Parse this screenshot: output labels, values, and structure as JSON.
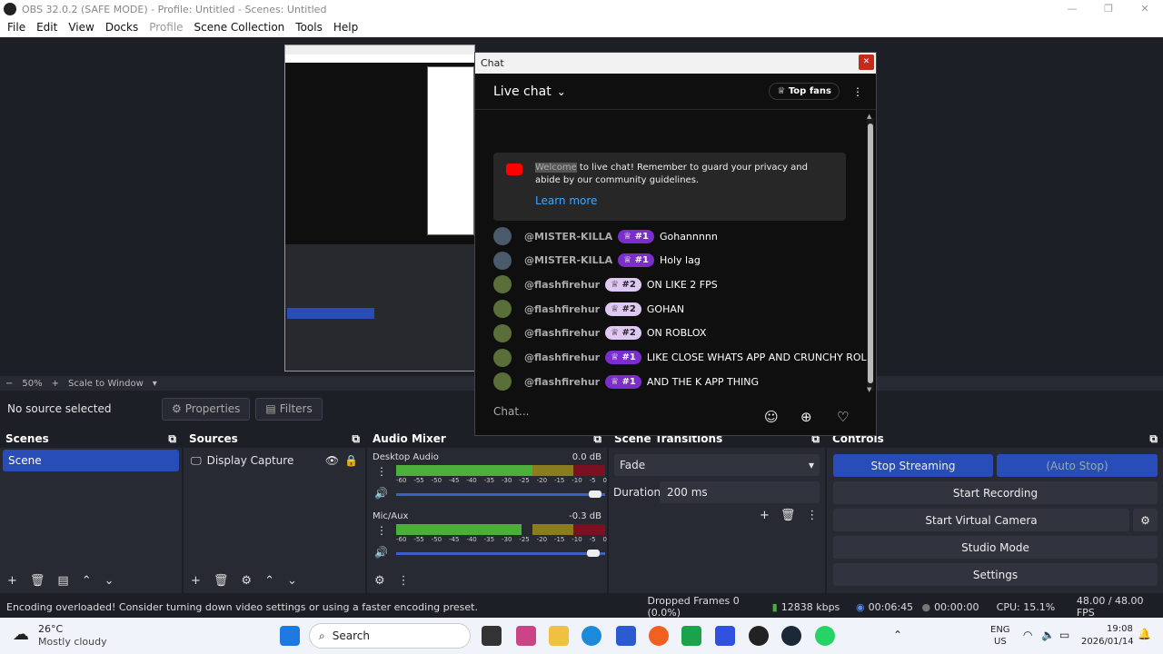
{
  "window": {
    "title": "OBS 32.0.2 (SAFE MODE) - Profile: Untitled - Scenes: Untitled"
  },
  "menu": [
    "File",
    "Edit",
    "View",
    "Docks",
    "Profile",
    "Scene Collection",
    "Tools",
    "Help"
  ],
  "preview": {
    "zoom": "50%",
    "scale_mode": "Scale to Window"
  },
  "propbar": {
    "no_source": "No source selected",
    "properties": "Properties",
    "filters": "Filters"
  },
  "scenes": {
    "title": "Scenes",
    "items": [
      "Scene"
    ]
  },
  "sources": {
    "title": "Sources",
    "items": [
      "Display Capture"
    ]
  },
  "mixer": {
    "title": "Audio Mixer",
    "tracks": [
      {
        "name": "Desktop Audio",
        "db": "0.0 dB",
        "level": 0.65
      },
      {
        "name": "Mic/Aux",
        "db": "-0.3 dB",
        "level": 0.6
      }
    ],
    "ticks": [
      "-60",
      "-55",
      "-50",
      "-45",
      "-40",
      "-35",
      "-30",
      "-25",
      "-20",
      "-15",
      "-10",
      "-5",
      "0"
    ]
  },
  "transitions": {
    "title": "Scene Transitions",
    "type": "Fade",
    "duration_label": "Duration",
    "duration": "200 ms"
  },
  "controls": {
    "title": "Controls",
    "stop_streaming": "Stop Streaming",
    "auto_stop": "(Auto Stop)",
    "start_recording": "Start Recording",
    "start_virtual_camera": "Start Virtual Camera",
    "studio_mode": "Studio Mode",
    "settings": "Settings"
  },
  "status": {
    "message": "Encoding overloaded! Consider turning down video settings or using a faster encoding preset.",
    "dropped": "Dropped Frames 0 (0.0%)",
    "bitrate": "12838 kbps",
    "stream_time": "00:06:45",
    "rec_time": "00:00:00",
    "cpu": "CPU: 15.1%",
    "fps": "48.00 / 48.00 FPS"
  },
  "chat": {
    "window_title": "Chat",
    "live_chat": "Live chat",
    "top_fans": "Top fans",
    "welcome_highlight": "Welcome",
    "welcome_text": " to live chat! Remember to guard your privacy and abide by our community guidelines.",
    "learn_more": "Learn more",
    "placeholder": "Chat...",
    "messages": [
      {
        "user": "@MISTER-KILLA",
        "badge": "#1",
        "text": "Gohannnnn"
      },
      {
        "user": "@MISTER-KILLA",
        "badge": "#1",
        "text": "Holy lag"
      },
      {
        "user": "@flashfirehur",
        "badge": "#2",
        "text": "ON LIKE 2 FPS"
      },
      {
        "user": "@flashfirehur",
        "badge": "#2",
        "text": "GOHAN"
      },
      {
        "user": "@flashfirehur",
        "badge": "#2",
        "text": "ON ROBLOX"
      },
      {
        "user": "@flashfirehur",
        "badge": "#1",
        "text": "LIKE CLOSE WHATS APP AND CRUNCHY ROLL"
      },
      {
        "user": "@flashfirehur",
        "badge": "#1",
        "text": "AND THE K APP THING"
      }
    ]
  },
  "taskbar": {
    "weather_temp": "26°C",
    "weather_desc": "Mostly cloudy",
    "search": "Search",
    "lang": "ENG",
    "region": "US",
    "time": "19:08",
    "date": "2026/01/14"
  }
}
